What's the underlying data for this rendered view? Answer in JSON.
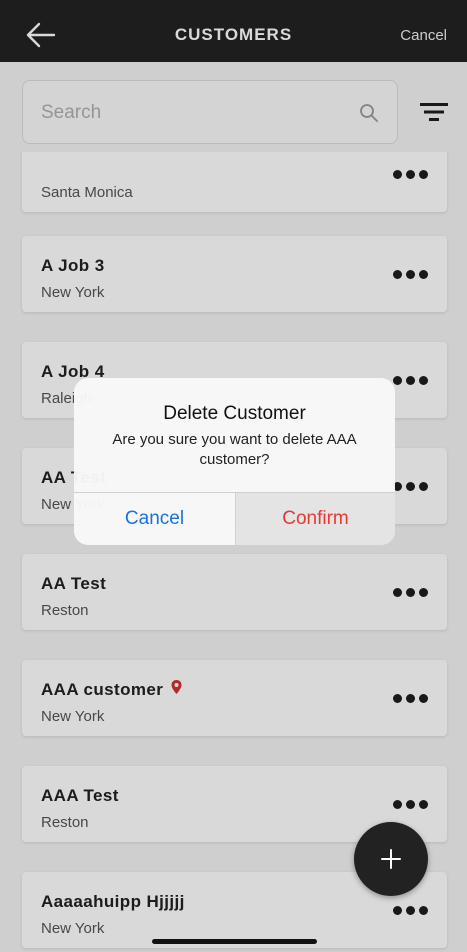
{
  "header": {
    "title": "CUSTOMERS",
    "cancel_label": "Cancel"
  },
  "search": {
    "placeholder": "Search"
  },
  "customers": [
    {
      "name": "",
      "city": "Santa Monica"
    },
    {
      "name": "A Job 3",
      "city": "New York"
    },
    {
      "name": "A Job 4",
      "city": "Raleigh"
    },
    {
      "name": "AA Test",
      "city": "New York"
    },
    {
      "name": "AA Test",
      "city": "Reston"
    },
    {
      "name": "AAA customer",
      "city": "New York",
      "has_location_pin": true
    },
    {
      "name": "AAA Test",
      "city": "Reston"
    },
    {
      "name": "Aaaaahuipp Hjjjjj",
      "city": "New York"
    }
  ],
  "dialog": {
    "title": "Delete Customer",
    "message": "Are you sure you want to delete AAA customer?",
    "cancel_label": "Cancel",
    "confirm_label": "Confirm"
  },
  "colors": {
    "header_bg": "#232323",
    "cancel_blue": "#1a73d9",
    "confirm_red": "#e53935",
    "pin_red": "#d32f2f"
  },
  "icons": [
    "back-arrow-icon",
    "search-icon",
    "filter-icon",
    "more-options-icon",
    "location-pin-icon",
    "add-icon"
  ]
}
